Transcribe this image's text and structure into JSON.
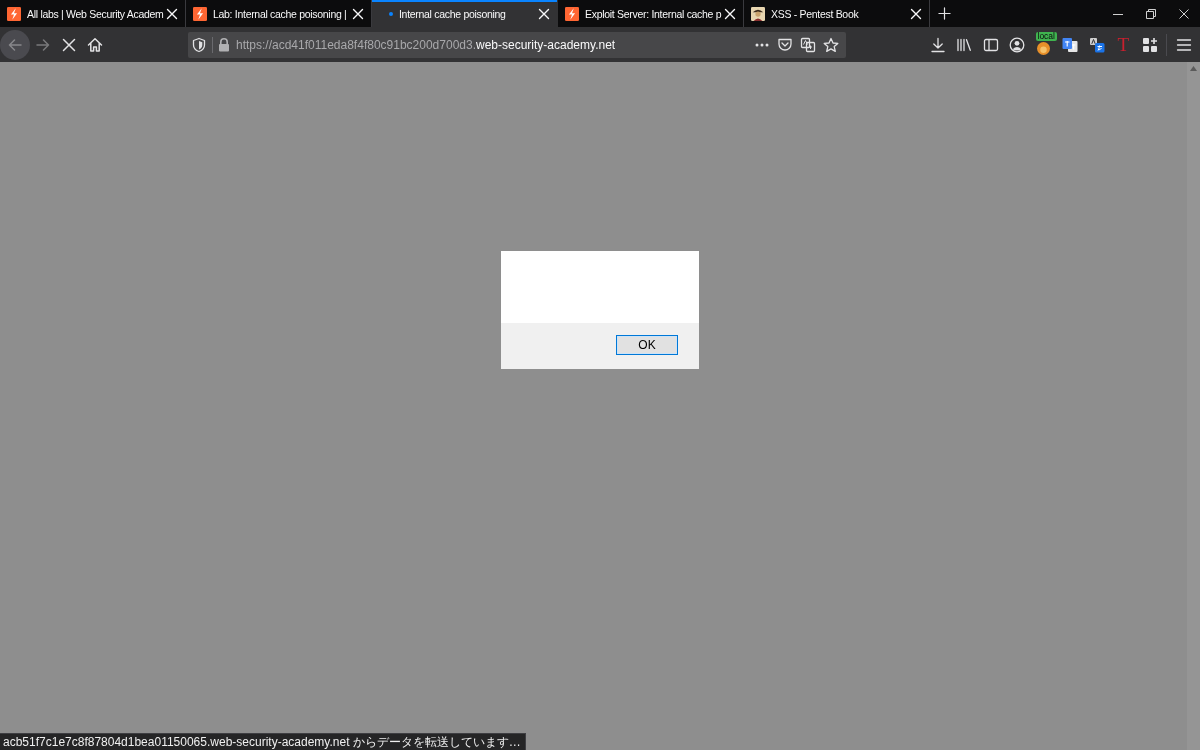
{
  "tabs": [
    {
      "title": "All labs | Web Security Academ",
      "kind": "lightning",
      "selected": false
    },
    {
      "title": "Lab: Internal cache poisoning |",
      "kind": "lightning",
      "selected": false
    },
    {
      "title": "Internal cache poisoning",
      "kind": "attention",
      "selected": true
    },
    {
      "title": "Exploit Server: Internal cache p",
      "kind": "lightning",
      "selected": false
    },
    {
      "title": "XSS - Pentest Book",
      "kind": "avatar",
      "selected": false
    }
  ],
  "navigation": [
    {
      "kind": "back",
      "disabled": true,
      "hovered": true
    },
    {
      "kind": "forward",
      "disabled": true,
      "hovered": false
    },
    {
      "kind": "stop",
      "disabled": false,
      "hovered": false
    },
    {
      "kind": "home",
      "disabled": false,
      "hovered": false
    }
  ],
  "address_bar": {
    "url_prefix": "https://acd41f011eda8f4f80c91bc200d700d3.",
    "url_domain": "web-security-academy.net"
  },
  "toolbar": {
    "extension_badge": "local",
    "extension_letter": "T"
  },
  "dialog": {
    "button": "OK",
    "focused": true
  },
  "status_bar": "acb51f7c1e7c8f87804d1bea01150065.web-security-academy.net からデータを転送しています…"
}
